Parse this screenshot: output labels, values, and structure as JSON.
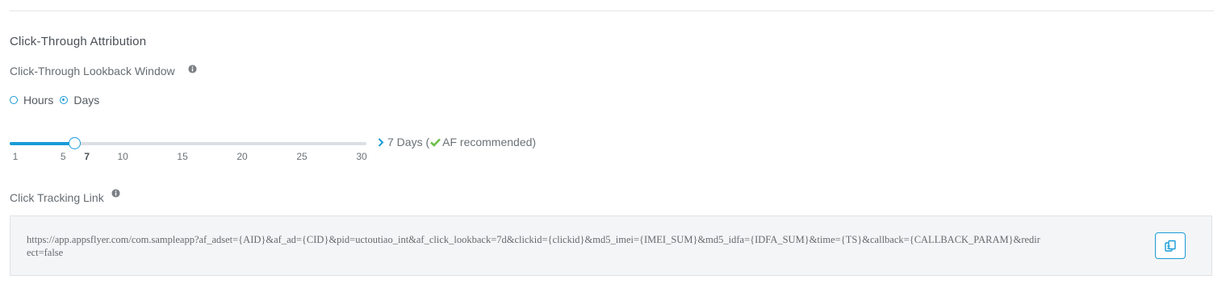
{
  "section": {
    "title": "Click-Through Attribution"
  },
  "lookback": {
    "label": "Click-Through Lookback Window",
    "info_icon": "info-icon",
    "unit_options": [
      {
        "label": "Hours",
        "selected": false
      },
      {
        "label": "Days",
        "selected": true
      }
    ],
    "slider": {
      "min": 1,
      "max": 30,
      "value": 7,
      "ticks": [
        "1",
        "5",
        "7",
        "10",
        "15",
        "20",
        "25",
        "30"
      ],
      "active_tick": "7"
    },
    "value_text": "7 Days (",
    "recommended_text": "AF recommended)",
    "accent_color": "#1a9bd7",
    "check_color": "#6cc04a"
  },
  "tracking_link": {
    "label": "Click Tracking Link",
    "info_icon": "info-icon",
    "url": "https://app.appsflyer.com/com.sampleapp?af_adset={AID}&af_ad={CID}&pid=uctoutiao_int&af_click_lookback=7d&clickid={clickid}&md5_imei={IMEI_SUM}&md5_idfa={IDFA_SUM}&time={TS}&callback={CALLBACK_PARAM}&redirect=false",
    "copy_icon": "copy-icon"
  }
}
